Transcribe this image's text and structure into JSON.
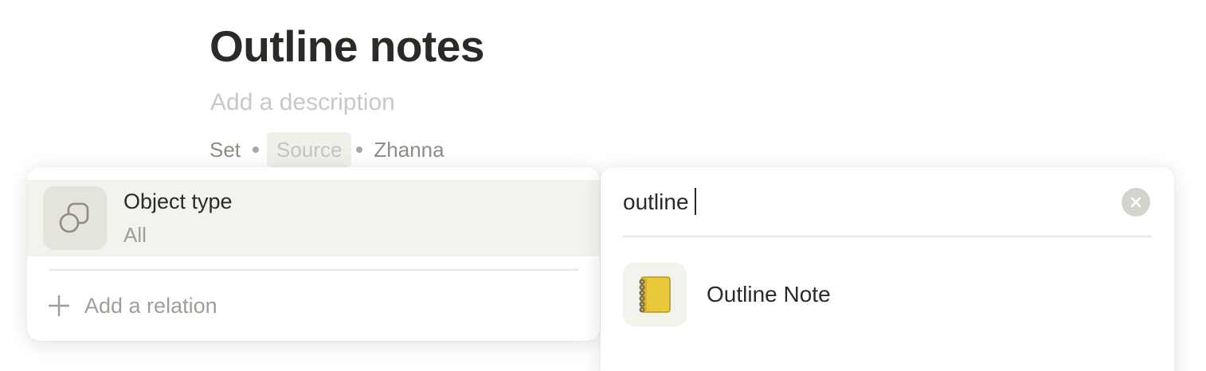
{
  "page": {
    "title": "Outline notes",
    "description_placeholder": "Add a description",
    "featured_relations": [
      "Set",
      "Source",
      "Zhanna"
    ]
  },
  "relation_menu": {
    "selected": {
      "name": "Object type",
      "value": "All",
      "icon": "object-type-icon"
    },
    "add_label": "Add a relation"
  },
  "type_search": {
    "query": "outline",
    "clear_icon": "clear-icon",
    "results": [
      {
        "label": "Outline Note",
        "icon": "notebook-icon"
      }
    ]
  }
}
